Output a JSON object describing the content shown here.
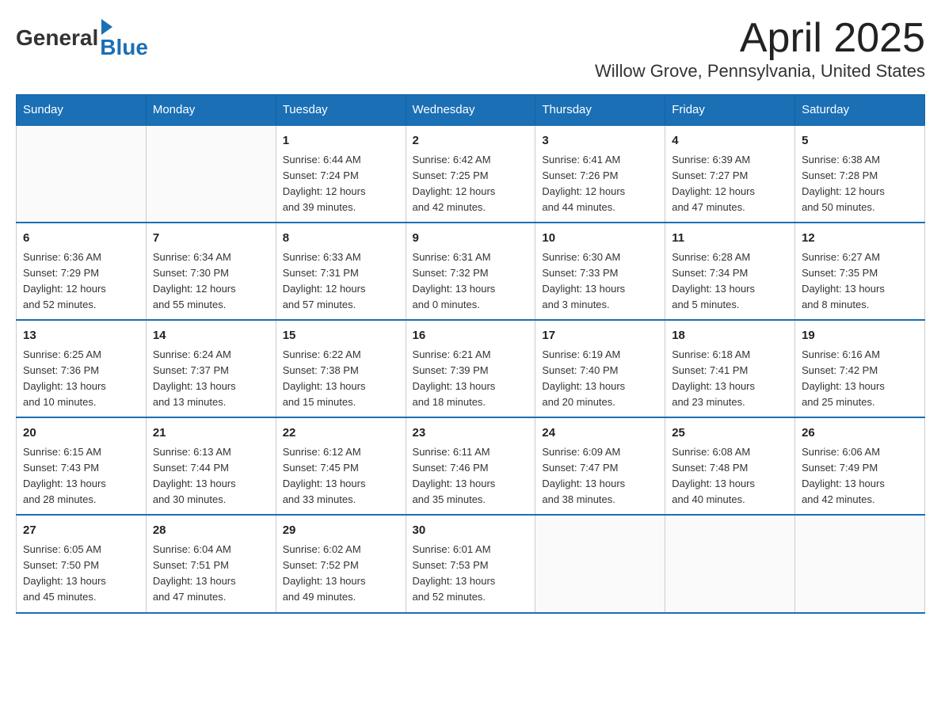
{
  "logo": {
    "general": "General",
    "blue": "Blue"
  },
  "header": {
    "month": "April 2025",
    "location": "Willow Grove, Pennsylvania, United States"
  },
  "weekdays": [
    "Sunday",
    "Monday",
    "Tuesday",
    "Wednesday",
    "Thursday",
    "Friday",
    "Saturday"
  ],
  "weeks": [
    [
      {
        "day": "",
        "info": ""
      },
      {
        "day": "",
        "info": ""
      },
      {
        "day": "1",
        "info": "Sunrise: 6:44 AM\nSunset: 7:24 PM\nDaylight: 12 hours\nand 39 minutes."
      },
      {
        "day": "2",
        "info": "Sunrise: 6:42 AM\nSunset: 7:25 PM\nDaylight: 12 hours\nand 42 minutes."
      },
      {
        "day": "3",
        "info": "Sunrise: 6:41 AM\nSunset: 7:26 PM\nDaylight: 12 hours\nand 44 minutes."
      },
      {
        "day": "4",
        "info": "Sunrise: 6:39 AM\nSunset: 7:27 PM\nDaylight: 12 hours\nand 47 minutes."
      },
      {
        "day": "5",
        "info": "Sunrise: 6:38 AM\nSunset: 7:28 PM\nDaylight: 12 hours\nand 50 minutes."
      }
    ],
    [
      {
        "day": "6",
        "info": "Sunrise: 6:36 AM\nSunset: 7:29 PM\nDaylight: 12 hours\nand 52 minutes."
      },
      {
        "day": "7",
        "info": "Sunrise: 6:34 AM\nSunset: 7:30 PM\nDaylight: 12 hours\nand 55 minutes."
      },
      {
        "day": "8",
        "info": "Sunrise: 6:33 AM\nSunset: 7:31 PM\nDaylight: 12 hours\nand 57 minutes."
      },
      {
        "day": "9",
        "info": "Sunrise: 6:31 AM\nSunset: 7:32 PM\nDaylight: 13 hours\nand 0 minutes."
      },
      {
        "day": "10",
        "info": "Sunrise: 6:30 AM\nSunset: 7:33 PM\nDaylight: 13 hours\nand 3 minutes."
      },
      {
        "day": "11",
        "info": "Sunrise: 6:28 AM\nSunset: 7:34 PM\nDaylight: 13 hours\nand 5 minutes."
      },
      {
        "day": "12",
        "info": "Sunrise: 6:27 AM\nSunset: 7:35 PM\nDaylight: 13 hours\nand 8 minutes."
      }
    ],
    [
      {
        "day": "13",
        "info": "Sunrise: 6:25 AM\nSunset: 7:36 PM\nDaylight: 13 hours\nand 10 minutes."
      },
      {
        "day": "14",
        "info": "Sunrise: 6:24 AM\nSunset: 7:37 PM\nDaylight: 13 hours\nand 13 minutes."
      },
      {
        "day": "15",
        "info": "Sunrise: 6:22 AM\nSunset: 7:38 PM\nDaylight: 13 hours\nand 15 minutes."
      },
      {
        "day": "16",
        "info": "Sunrise: 6:21 AM\nSunset: 7:39 PM\nDaylight: 13 hours\nand 18 minutes."
      },
      {
        "day": "17",
        "info": "Sunrise: 6:19 AM\nSunset: 7:40 PM\nDaylight: 13 hours\nand 20 minutes."
      },
      {
        "day": "18",
        "info": "Sunrise: 6:18 AM\nSunset: 7:41 PM\nDaylight: 13 hours\nand 23 minutes."
      },
      {
        "day": "19",
        "info": "Sunrise: 6:16 AM\nSunset: 7:42 PM\nDaylight: 13 hours\nand 25 minutes."
      }
    ],
    [
      {
        "day": "20",
        "info": "Sunrise: 6:15 AM\nSunset: 7:43 PM\nDaylight: 13 hours\nand 28 minutes."
      },
      {
        "day": "21",
        "info": "Sunrise: 6:13 AM\nSunset: 7:44 PM\nDaylight: 13 hours\nand 30 minutes."
      },
      {
        "day": "22",
        "info": "Sunrise: 6:12 AM\nSunset: 7:45 PM\nDaylight: 13 hours\nand 33 minutes."
      },
      {
        "day": "23",
        "info": "Sunrise: 6:11 AM\nSunset: 7:46 PM\nDaylight: 13 hours\nand 35 minutes."
      },
      {
        "day": "24",
        "info": "Sunrise: 6:09 AM\nSunset: 7:47 PM\nDaylight: 13 hours\nand 38 minutes."
      },
      {
        "day": "25",
        "info": "Sunrise: 6:08 AM\nSunset: 7:48 PM\nDaylight: 13 hours\nand 40 minutes."
      },
      {
        "day": "26",
        "info": "Sunrise: 6:06 AM\nSunset: 7:49 PM\nDaylight: 13 hours\nand 42 minutes."
      }
    ],
    [
      {
        "day": "27",
        "info": "Sunrise: 6:05 AM\nSunset: 7:50 PM\nDaylight: 13 hours\nand 45 minutes."
      },
      {
        "day": "28",
        "info": "Sunrise: 6:04 AM\nSunset: 7:51 PM\nDaylight: 13 hours\nand 47 minutes."
      },
      {
        "day": "29",
        "info": "Sunrise: 6:02 AM\nSunset: 7:52 PM\nDaylight: 13 hours\nand 49 minutes."
      },
      {
        "day": "30",
        "info": "Sunrise: 6:01 AM\nSunset: 7:53 PM\nDaylight: 13 hours\nand 52 minutes."
      },
      {
        "day": "",
        "info": ""
      },
      {
        "day": "",
        "info": ""
      },
      {
        "day": "",
        "info": ""
      }
    ]
  ]
}
